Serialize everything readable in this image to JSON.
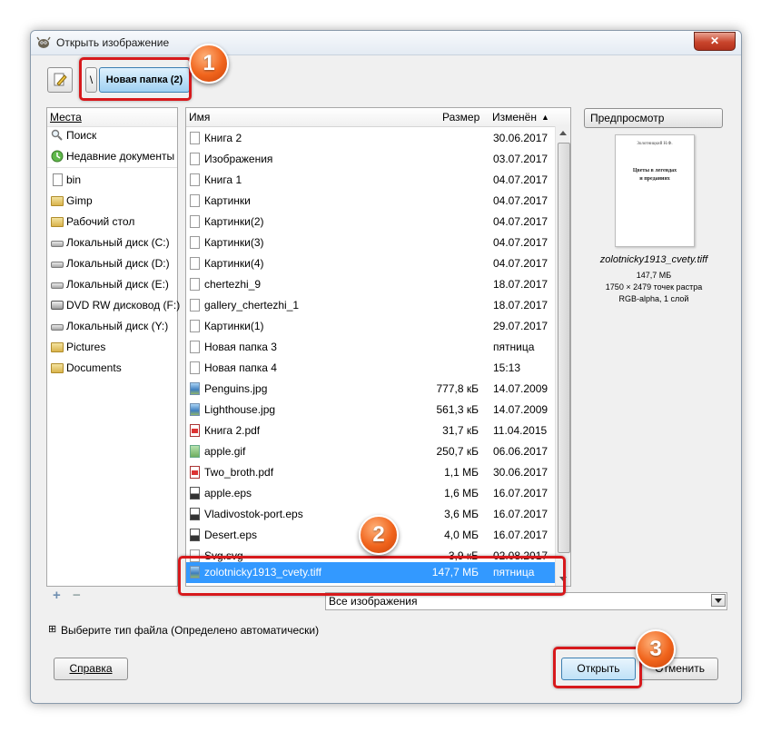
{
  "window": {
    "title": "Открыть изображение",
    "close_label": "✕"
  },
  "path_bar": {
    "root_label": "\\",
    "current_folder": "Новая папка (2)"
  },
  "places": {
    "header": "Места",
    "items": [
      {
        "label": "Поиск",
        "icon": "search-icon"
      },
      {
        "label": "Недавние документы",
        "icon": "recent-icon"
      },
      {
        "label": "bin",
        "icon": "document-icon"
      },
      {
        "label": "Gimp",
        "icon": "folder-icon"
      },
      {
        "label": "Рабочий стол",
        "icon": "folder-icon"
      },
      {
        "label": "Локальный диск (C:)",
        "icon": "disk-icon"
      },
      {
        "label": "Локальный диск (D:)",
        "icon": "disk-icon"
      },
      {
        "label": "Локальный диск (E:)",
        "icon": "disk-icon"
      },
      {
        "label": "DVD RW дисковод (F:)",
        "icon": "dvd-icon"
      },
      {
        "label": "Локальный диск (Y:)",
        "icon": "disk-icon"
      },
      {
        "label": "Pictures",
        "icon": "folder-icon"
      },
      {
        "label": "Documents",
        "icon": "folder-icon"
      }
    ],
    "add_label": "+",
    "remove_label": "−"
  },
  "file_list": {
    "columns": {
      "name": "Имя",
      "size": "Размер",
      "modified": "Изменён"
    },
    "sort_indicator": "▲",
    "rows": [
      {
        "name": "Книга 2",
        "size": "",
        "modified": "30.06.2017",
        "type": "doc"
      },
      {
        "name": "Изображения",
        "size": "",
        "modified": "03.07.2017",
        "type": "doc"
      },
      {
        "name": "Книга 1",
        "size": "",
        "modified": "04.07.2017",
        "type": "doc"
      },
      {
        "name": "Картинки",
        "size": "",
        "modified": "04.07.2017",
        "type": "doc"
      },
      {
        "name": "Картинки(2)",
        "size": "",
        "modified": "04.07.2017",
        "type": "doc"
      },
      {
        "name": "Картинки(3)",
        "size": "",
        "modified": "04.07.2017",
        "type": "doc"
      },
      {
        "name": "Картинки(4)",
        "size": "",
        "modified": "04.07.2017",
        "type": "doc"
      },
      {
        "name": "chertezhi_9",
        "size": "",
        "modified": "18.07.2017",
        "type": "doc"
      },
      {
        "name": "gallery_chertezhi_1",
        "size": "",
        "modified": "18.07.2017",
        "type": "doc"
      },
      {
        "name": "Картинки(1)",
        "size": "",
        "modified": "29.07.2017",
        "type": "doc"
      },
      {
        "name": "Новая папка 3",
        "size": "",
        "modified": "пятница",
        "type": "doc"
      },
      {
        "name": "Новая папка 4",
        "size": "",
        "modified": "15:13",
        "type": "doc"
      },
      {
        "name": "Penguins.jpg",
        "size": "777,8 кБ",
        "modified": "14.07.2009",
        "type": "img"
      },
      {
        "name": "Lighthouse.jpg",
        "size": "561,3 кБ",
        "modified": "14.07.2009",
        "type": "img"
      },
      {
        "name": "Книга 2.pdf",
        "size": "31,7 кБ",
        "modified": "11.04.2015",
        "type": "pdf"
      },
      {
        "name": "apple.gif",
        "size": "250,7 кБ",
        "modified": "06.06.2017",
        "type": "gif"
      },
      {
        "name": "Two_broth.pdf",
        "size": "1,1 МБ",
        "modified": "30.06.2017",
        "type": "pdf"
      },
      {
        "name": "apple.eps",
        "size": "1,6 МБ",
        "modified": "16.07.2017",
        "type": "eps"
      },
      {
        "name": "Vladivostok-port.eps",
        "size": "3,6 МБ",
        "modified": "16.07.2017",
        "type": "eps"
      },
      {
        "name": "Desert.eps",
        "size": "4,0 МБ",
        "modified": "16.07.2017",
        "type": "eps"
      },
      {
        "name": "Svg.svg",
        "size": "3,9 кБ",
        "modified": "02.08.2017",
        "type": "doc"
      }
    ],
    "selected_row": {
      "name": "zolotnicky1913_cvety.tiff",
      "size": "147,7 МБ",
      "modified": "пятница",
      "type": "img"
    }
  },
  "filter": {
    "selected": "Все изображения"
  },
  "preview": {
    "button_label": "Предпросмотр",
    "thumb_author": "Золотницкий Н.Ф.",
    "thumb_title_line1": "Цветы в легендах",
    "thumb_title_line2": "и преданиях",
    "filename": "zolotnicky1913_cvety.tiff",
    "size": "147,7 МБ",
    "dimensions": "1750 × 2479 точек растра",
    "mode": "RGB-alpha, 1 слой"
  },
  "file_type": {
    "expander": "⊞",
    "label": "Выберите тип файла (Определено автоматически)"
  },
  "buttons": {
    "help": "Справка",
    "open": "Открыть",
    "cancel": "Отменить"
  },
  "badges": {
    "one": "1",
    "two": "2",
    "three": "3"
  },
  "colors": {
    "selection": "#3399ff",
    "highlight_frame": "#d7191c",
    "badge": "#f0641c"
  }
}
